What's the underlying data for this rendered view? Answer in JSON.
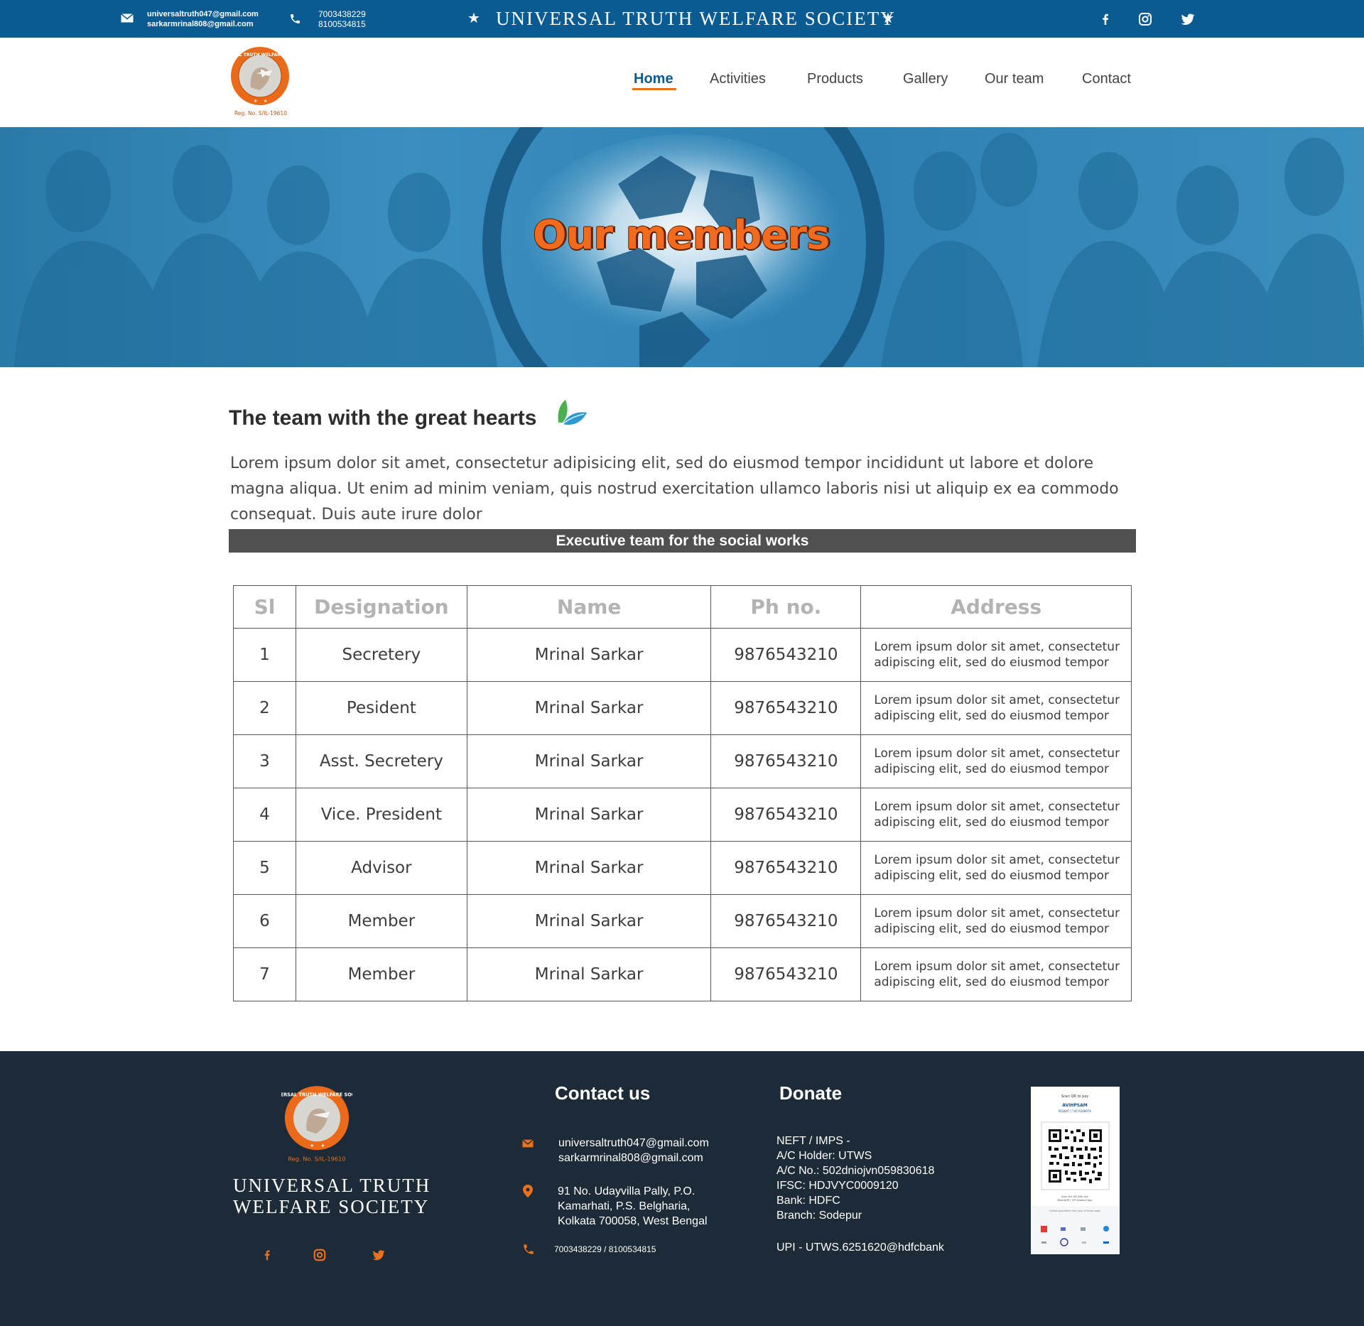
{
  "topbar": {
    "emails": [
      "universaltruth047@gmail.com",
      "sarkarmrinal808@gmail.com"
    ],
    "phones": [
      "7003438229",
      "8100534815"
    ],
    "title": "UNIVERSAL TRUTH WELFARE SOCIETY",
    "star": "★",
    "social": [
      "facebook-icon",
      "instagram-icon",
      "twitter-icon"
    ]
  },
  "logo": {
    "ring_text": "UNIVERSAL TRUTH WELFARE SOCIETY",
    "reg": "Reg. No. S/IL-19610"
  },
  "nav": {
    "items": [
      "Home",
      "Activities",
      "Products",
      "Gallery",
      "Our team",
      "Contact"
    ],
    "active": "Home"
  },
  "hero": {
    "title": "Our members"
  },
  "intro": {
    "title": "The team with the great hearts",
    "text": "Lorem ipsum dolor sit amet, consectetur adipisicing elit, sed do eiusmod tempor incididunt ut labore et dolore magna aliqua. Ut enim ad minim veniam, quis nostrud exercitation ullamco laboris nisi ut aliquip ex ea commodo consequat. Duis aute irure dolor"
  },
  "exec_band": "Executive team for the social works",
  "table": {
    "headers": [
      "Sl",
      "Designation",
      "Name",
      "Ph no.",
      "Address"
    ],
    "rows": [
      [
        "1",
        "Secretery",
        "Mrinal Sarkar",
        "9876543210",
        "Lorem ipsum dolor sit amet, consectetur adipiscing elit, sed do eiusmod tempor"
      ],
      [
        "2",
        "Pesident",
        "Mrinal Sarkar",
        "9876543210",
        "Lorem ipsum dolor sit amet, consectetur adipiscing elit, sed do eiusmod tempor"
      ],
      [
        "3",
        "Asst. Secretery",
        "Mrinal Sarkar",
        "9876543210",
        "Lorem ipsum dolor sit amet, consectetur adipiscing elit, sed do eiusmod tempor"
      ],
      [
        "4",
        "Vice. President",
        "Mrinal Sarkar",
        "9876543210",
        "Lorem ipsum dolor sit amet, consectetur adipiscing elit, sed do eiusmod tempor"
      ],
      [
        "5",
        "Advisor",
        "Mrinal Sarkar",
        "9876543210",
        "Lorem ipsum dolor sit amet, consectetur adipiscing elit, sed do eiusmod tempor"
      ],
      [
        "6",
        "Member",
        "Mrinal Sarkar",
        "9876543210",
        "Lorem ipsum dolor sit amet, consectetur adipiscing elit, sed do eiusmod tempor"
      ],
      [
        "7",
        "Member",
        "Mrinal Sarkar",
        "9876543210",
        "Lorem ipsum dolor sit amet, consectetur adipiscing elit, sed do eiusmod tempor"
      ]
    ]
  },
  "footer": {
    "org_line1": "UNIVERSAL TRUTH",
    "org_line2": "WELFARE SOCIETY",
    "contact": {
      "heading": "Contact us",
      "emails": [
        "universaltruth047@gmail.com",
        "sarkarmrinal808@gmail.com"
      ],
      "address": [
        "91 No. Udayvilla Pally, P.O.",
        "Kamarhati, P.S. Belgharia,",
        "Kolkata 700058, West Bengal"
      ],
      "phones": "7003438229 / 8100534815"
    },
    "donate": {
      "heading": "Donate",
      "lines": [
        "NEFT / IMPS -",
        "A/C Holder: UTWS",
        "A/C No.: 502dniojvn059830618",
        "IFSC: HDJVYC0009120",
        "Bank: HDFC",
        "Branch: Sodepur"
      ],
      "upi": "UPI - UTWS.6251620@hdfcbank"
    },
    "qr": {
      "scan_label": "Scan QR to pay",
      "payee": "AVIHPSAM",
      "city": "KOLKAT  |  745 6248976",
      "hint1": "Scan the QR with any",
      "hint2": "BharatQR / UPI enabled app",
      "collect": "Collect payments from any of these apps"
    }
  },
  "colors": {
    "topbar": "#0a5b92",
    "accent": "#e8711e",
    "footer": "#1c2b37",
    "band": "#505050"
  }
}
